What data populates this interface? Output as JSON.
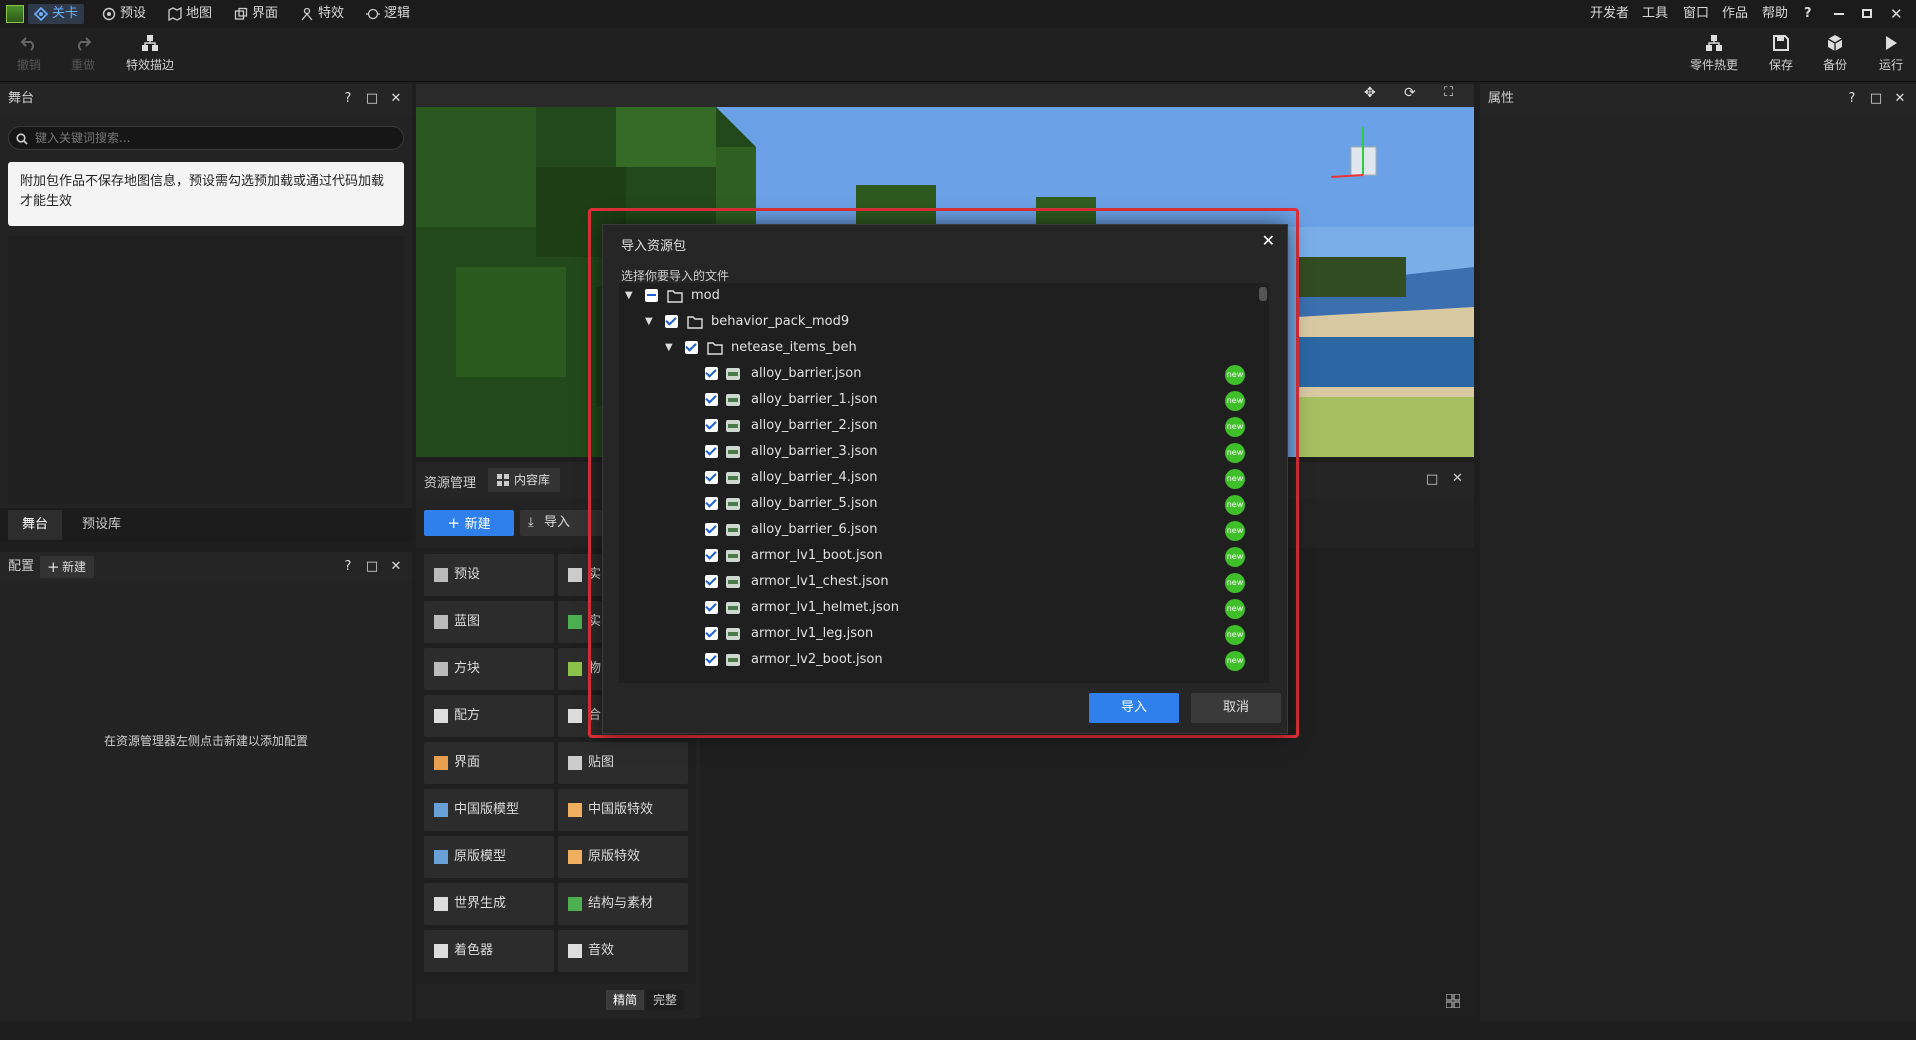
{
  "menubar": {
    "items": [
      {
        "label": "关卡",
        "icon": "level-icon",
        "active": true
      },
      {
        "label": "预设",
        "icon": "preset-icon"
      },
      {
        "label": "地图",
        "icon": "map-icon"
      },
      {
        "label": "界面",
        "icon": "ui-icon"
      },
      {
        "label": "特效",
        "icon": "effect-icon"
      },
      {
        "label": "逻辑",
        "icon": "logic-icon"
      }
    ],
    "right_items": [
      "开发者",
      "工具",
      "窗口",
      "作品",
      "帮助",
      "?"
    ]
  },
  "toolbar": {
    "undo_label": "撤销",
    "redo_label": "重做",
    "outline_label": "特效描边",
    "hotupdate_label": "零件热更",
    "save_label": "保存",
    "backup_label": "备份",
    "run_label": "运行"
  },
  "stage_panel": {
    "title": "舞台",
    "search_placeholder": "键入关键词搜索...",
    "notice": "附加包作品不保存地图信息，预设需勾选预加载或通过代码加载才能生效",
    "tabs": [
      "舞台",
      "预设库"
    ]
  },
  "config_panel": {
    "title": "配置",
    "new_label": "新建",
    "empty_hint": "在资源管理器左侧点击新建以添加配置"
  },
  "properties_panel": {
    "title": "属性"
  },
  "resource_panel": {
    "title": "资源管理",
    "content_tab": "内容库",
    "new_label": "新建",
    "import_label": "导入",
    "left_items": [
      "预设",
      "蓝图",
      "方块",
      "配方",
      "界面",
      "中国版模型",
      "原版模型",
      "世界生成",
      "着色器"
    ],
    "right_items": [
      "实",
      "实",
      "物",
      "合",
      "贴图",
      "中国版特效",
      "原版特效",
      "结构与素材",
      "音效"
    ],
    "view_simple": "精简",
    "view_full": "完整"
  },
  "dialog": {
    "title": "导入资源包",
    "prompt": "选择你要导入的文件",
    "import_button": "导入",
    "cancel_button": "取消",
    "badge_text": "new",
    "tree": [
      {
        "label": "mod",
        "level": 0,
        "type": "folder",
        "state": "partial"
      },
      {
        "label": "behavior_pack_mod9",
        "level": 1,
        "type": "folder",
        "state": "checked"
      },
      {
        "label": "netease_items_beh",
        "level": 2,
        "type": "folder",
        "state": "checked"
      },
      {
        "label": "alloy_barrier.json",
        "level": 3,
        "type": "file",
        "state": "checked",
        "new": true
      },
      {
        "label": "alloy_barrier_1.json",
        "level": 3,
        "type": "file",
        "state": "checked",
        "new": true
      },
      {
        "label": "alloy_barrier_2.json",
        "level": 3,
        "type": "file",
        "state": "checked",
        "new": true
      },
      {
        "label": "alloy_barrier_3.json",
        "level": 3,
        "type": "file",
        "state": "checked",
        "new": true
      },
      {
        "label": "alloy_barrier_4.json",
        "level": 3,
        "type": "file",
        "state": "checked",
        "new": true
      },
      {
        "label": "alloy_barrier_5.json",
        "level": 3,
        "type": "file",
        "state": "checked",
        "new": true
      },
      {
        "label": "alloy_barrier_6.json",
        "level": 3,
        "type": "file",
        "state": "checked",
        "new": true
      },
      {
        "label": "armor_lv1_boot.json",
        "level": 3,
        "type": "file",
        "state": "checked",
        "new": true
      },
      {
        "label": "armor_lv1_chest.json",
        "level": 3,
        "type": "file",
        "state": "checked",
        "new": true
      },
      {
        "label": "armor_lv1_helmet.json",
        "level": 3,
        "type": "file",
        "state": "checked",
        "new": true
      },
      {
        "label": "armor_lv1_leg.json",
        "level": 3,
        "type": "file",
        "state": "checked",
        "new": true
      },
      {
        "label": "armor_lv2_boot.json",
        "level": 3,
        "type": "file",
        "state": "checked",
        "new": true
      }
    ]
  },
  "colors": {
    "accent": "#2f80ed",
    "highlight": "#e0303a",
    "new_badge": "#3fbf2a"
  }
}
